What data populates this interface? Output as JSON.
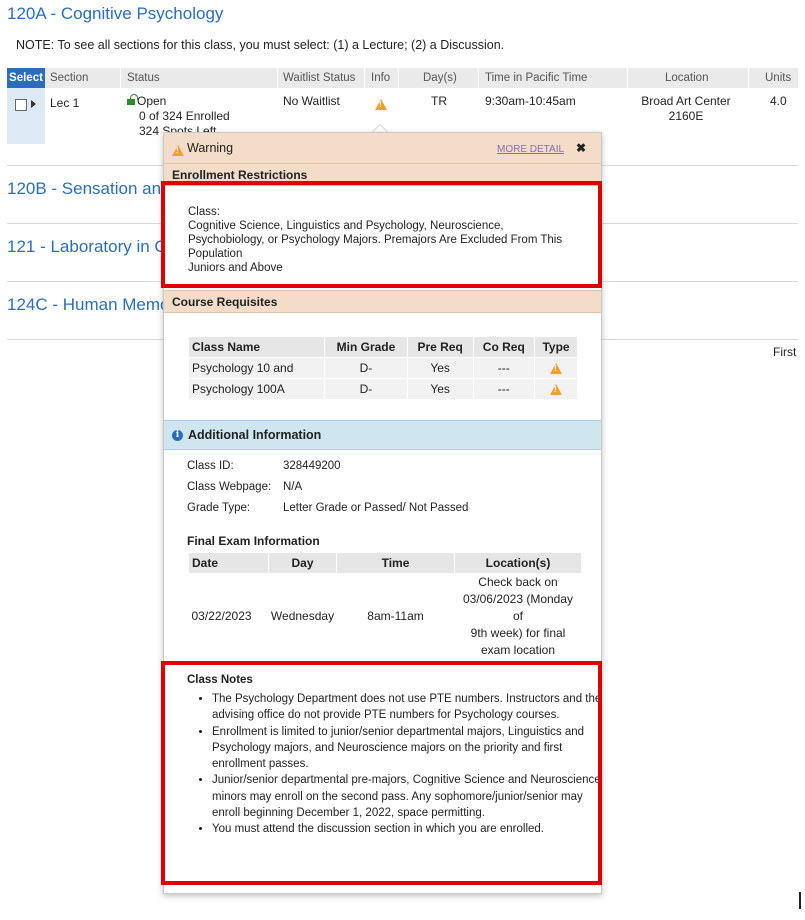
{
  "courses": {
    "c1_title": "120A - Cognitive Psychology",
    "c2_title": "120B - Sensation an",
    "c3_title": "121 - Laboratory in C",
    "c4_title": "124C - Human Memo"
  },
  "note": "NOTE: To see all sections for this class, you must select: (1) a Lecture; (2) a Discussion.",
  "headers": {
    "select": "Select",
    "section": "Section",
    "status": "Status",
    "waitlist": "Waitlist Status",
    "info": "Info",
    "days": "Day(s)",
    "time": "Time in Pacific Time",
    "location": "Location",
    "units": "Units"
  },
  "row": {
    "section": "Lec 1",
    "status_open": "Open",
    "enrolled": "0 of 324 Enrolled",
    "spots": "324 Spots Left",
    "waitlist": "No Waitlist",
    "days": "TR",
    "time": "9:30am-10:45am",
    "location_line1": "Broad Art Center",
    "location_line2": "2160E",
    "units": "4.0"
  },
  "pager": {
    "first": "First"
  },
  "popup": {
    "title": "Warning",
    "more_detail": "MORE DETAIL",
    "close": "✖",
    "enroll_title": "Enrollment Restrictions",
    "class_label": "Class:",
    "restriction_line1": "Cognitive Science, Linguistics and Psychology, Neuroscience,",
    "restriction_line2": "Psychobiology, or Psychology Majors. Premajors Are Excluded From This",
    "restriction_line3": "Population",
    "restriction_line4": "Juniors and Above",
    "req_title": "Course Requisites",
    "req_headers": {
      "name": "Class Name",
      "min": "Min Grade",
      "pre": "Pre Req",
      "co": "Co Req",
      "type": "Type"
    },
    "req_rows": [
      {
        "name": "Psychology 10 and",
        "min": "D-",
        "pre": "Yes",
        "co": "---"
      },
      {
        "name": "Psychology 100A",
        "min": "D-",
        "pre": "Yes",
        "co": "---"
      }
    ],
    "add_title": "Additional Information",
    "class_id_label": "Class ID:",
    "class_id": "328449200",
    "webpage_label": "Class Webpage:",
    "webpage": "N/A",
    "grade_label": "Grade Type:",
    "grade": "Letter Grade or Passed/ Not Passed",
    "final_title": "Final Exam Information",
    "final_headers": {
      "date": "Date",
      "day": "Day",
      "time": "Time",
      "loc": "Location(s)"
    },
    "final_row": {
      "date": "03/22/2023",
      "day": "Wednesday",
      "time": "8am-11am",
      "loc1": "Check back on",
      "loc2": "03/06/2023 (Monday of",
      "loc3": "9th week) for final",
      "loc4": "exam location"
    },
    "notes_title": "Class Notes",
    "notes": [
      "The Psychology Department does not use PTE numbers. Instructors and the advising office do not provide PTE numbers for Psychology courses.",
      "Enrollment is limited to junior/senior departmental majors, Linguistics and Psychology majors, and Neuroscience majors on the priority and first enrollment passes.",
      "Junior/senior departmental pre-majors, Cognitive Science and Neuroscience minors may enroll on the second pass. Any sophomore/junior/senior may enroll beginning December 1, 2022, space permitting.",
      "You must attend the discussion section in which you are enrolled."
    ]
  }
}
